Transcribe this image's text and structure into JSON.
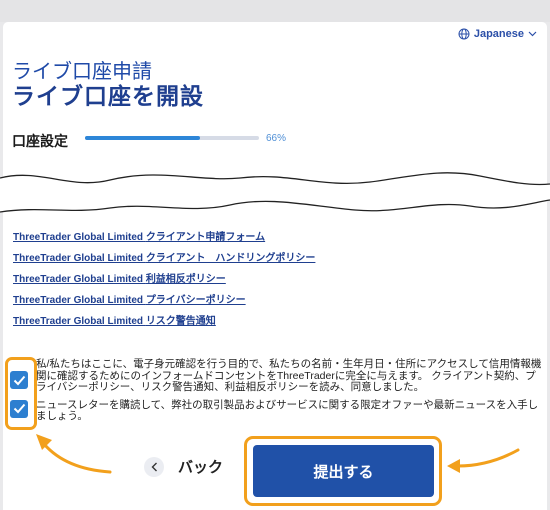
{
  "header": {
    "language_label": "Japanese",
    "globe_icon": "globe-icon",
    "chevron_icon": "chevron-down-icon"
  },
  "form": {
    "subtitle": "ライブ口座申請",
    "title": "ライブ口座を開設",
    "step_label": "口座設定",
    "progress_percent": 66,
    "progress_text": "66%"
  },
  "links": [
    {
      "brand": "ThreeTrader Global Limited",
      "text": "クライアント申請フォーム"
    },
    {
      "brand": "ThreeTrader Global Limited",
      "text": "クライアント　ハンドリングポリシー"
    },
    {
      "brand": "ThreeTrader Global Limited",
      "text": "利益相反ポリシー"
    },
    {
      "brand": "ThreeTrader Global Limited",
      "text": "プライバシーポリシー"
    },
    {
      "brand": "ThreeTrader Global Limited",
      "text": "リスク警告通知"
    }
  ],
  "consents": [
    {
      "checked": true,
      "text": "私/私たちはここに、電子身元確認を行う目的で、私たちの名前・生年月日・住所にアクセスして信用情報機関に確認するためにのインフォームドコンセントをThreeTraderに完全に与えます。 クライアント契約、プライバシーポリシー、リスク警告通知、利益相反ポリシーを読み、同意しました。"
    },
    {
      "checked": true,
      "text": "ニュースレターを購読して、弊社の取引製品およびサービスに関する限定オファーや最新ニュースを入手しましょう。"
    }
  ],
  "actions": {
    "back_label": "バック",
    "submit_label": "提出する"
  },
  "colors": {
    "accent": "#2051a8",
    "progress": "#2d86d8",
    "highlight": "#f2a01c",
    "checkbox": "#2d7fd0"
  }
}
